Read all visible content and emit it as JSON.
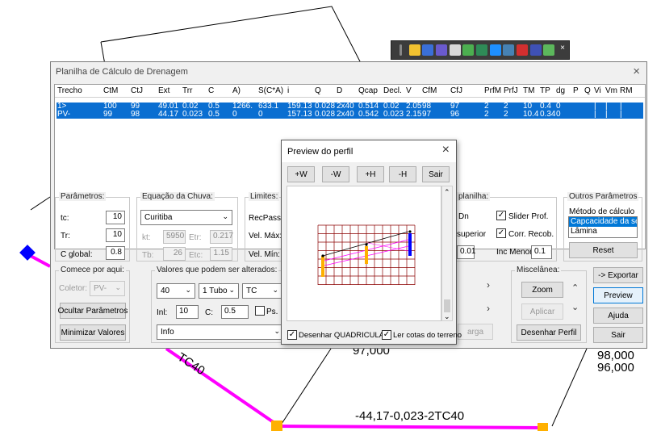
{
  "cad": {
    "label_tc40_left": "TC40",
    "label_97": "97,000",
    "label_98": "98,000",
    "label_96": "96,000",
    "label_bottom": "-44,17-0,023-2TC40"
  },
  "toolbar": {
    "icons": [
      "toolbar-icon-1",
      "toolbar-icon-2",
      "toolbar-icon-3",
      "toolbar-icon-4",
      "toolbar-icon-5",
      "toolbar-icon-6",
      "toolbar-icon-7",
      "toolbar-icon-8",
      "toolbar-icon-9",
      "toolbar-icon-10",
      "toolbar-icon-11",
      "toolbar-icon-12"
    ],
    "close": "×"
  },
  "main_window": {
    "title": "Planilha de Cálculo de Drenagem",
    "close": "×",
    "grid": {
      "headers": [
        "Trecho",
        "CtM",
        "CtJ",
        "Ext",
        "Trr",
        "C",
        "A)",
        "S(C*A)",
        "i",
        "Q",
        "D",
        "Qcap",
        "Decl.",
        "V",
        "CfM",
        "CfJ",
        "PrfM",
        "PrfJ",
        "TM",
        "TP",
        "dg",
        "P",
        "Q",
        "Vi",
        "Vm",
        "RM"
      ],
      "rows": [
        [
          "1>",
          "100",
          "99",
          "49.01",
          "0.02",
          "0.5",
          "1266.",
          "633.1",
          "159.13",
          "0.028",
          "2x40",
          "0.514",
          "0.02",
          "2.05",
          "98",
          "97",
          "2",
          "2",
          "10",
          "0.4",
          "0",
          "",
          "",
          "|",
          "|",
          "|"
        ],
        [
          "PV-",
          "99",
          "98",
          "44.17",
          "0.023",
          "0.5",
          "0",
          "0",
          "157.13",
          "0.028",
          "2x40",
          "0.542",
          "0.023",
          "2.15",
          "97",
          "96",
          "2",
          "2",
          "10.4",
          "0.34",
          "0",
          "",
          "",
          "|",
          "|",
          "|"
        ]
      ]
    },
    "parametros": {
      "label": "Parâmetros:",
      "tc_label": "tc:",
      "tc_value": "10",
      "tr_label": "Tr:",
      "tr_value": "10",
      "cglobal_label": "C global:",
      "cglobal_value": "0.8"
    },
    "equacao": {
      "label": "Equação da Chuva:",
      "city": "Curitiba",
      "kt_label": "kt:",
      "kt_value": "5950",
      "etr_label": "Etr:",
      "etr_value": "0.217",
      "tb_label": "Tb:",
      "tb_value": "26",
      "etc_label": "Etc:",
      "etc_value": "1.15"
    },
    "limites": {
      "label": "Limites:",
      "recpass": "RecPass.",
      "velmax": "Vel. Máx:",
      "velmin": "Vel. Mín:"
    },
    "planilha": {
      "label": "planilha:",
      "dn": "Dn",
      "superior": "superior",
      "value": "0.01",
      "slider_prof": "Slider Prof.",
      "corr_recob": "Corr. Recob.",
      "inc_menor": "Inc Menor",
      "inc_value": "0.1"
    },
    "outros": {
      "label": "Outros Parâmetros",
      "metodo": "Método de cálculo",
      "options": [
        "Capcacidade da seç",
        "Lâmina"
      ],
      "reset": "Reset"
    },
    "comece": {
      "label": "Comece por aqui:",
      "coletor_label": "Coletor:",
      "coletor_value": "PV-",
      "ocultar": "Ocultar Parâmetros",
      "minimizar": "Minimizar Valores"
    },
    "valores": {
      "label": "Valores que podem ser alterados:",
      "diam": "40",
      "tubos": "1 Tubo",
      "tipo": "TC",
      "inl_label": "Inl:",
      "inl_value": "10",
      "c_label": "C:",
      "c_value": "0.5",
      "ps_label": "Ps.",
      "info": "Info"
    },
    "middle": {
      "arrow1": "›",
      "arrow2": "›",
      "button": "arga"
    },
    "miscelanea": {
      "label": "Miscelânea:",
      "zoom": "Zoom",
      "aplicar": "Aplicar",
      "desenhar_perfil": "Desenhar Perfil"
    },
    "right_buttons": {
      "exportar": "-> Exportar",
      "preview": "Preview",
      "ajuda": "Ajuda",
      "sair": "Sair"
    }
  },
  "preview": {
    "title": "Preview do perfil",
    "close": "×",
    "buttons": [
      "+W",
      "-W",
      "+H",
      "-H",
      "Sair"
    ],
    "chk_quadricula": "Desenhar QUADRICULA",
    "chk_cotas": "Ler cotas do terreno"
  }
}
